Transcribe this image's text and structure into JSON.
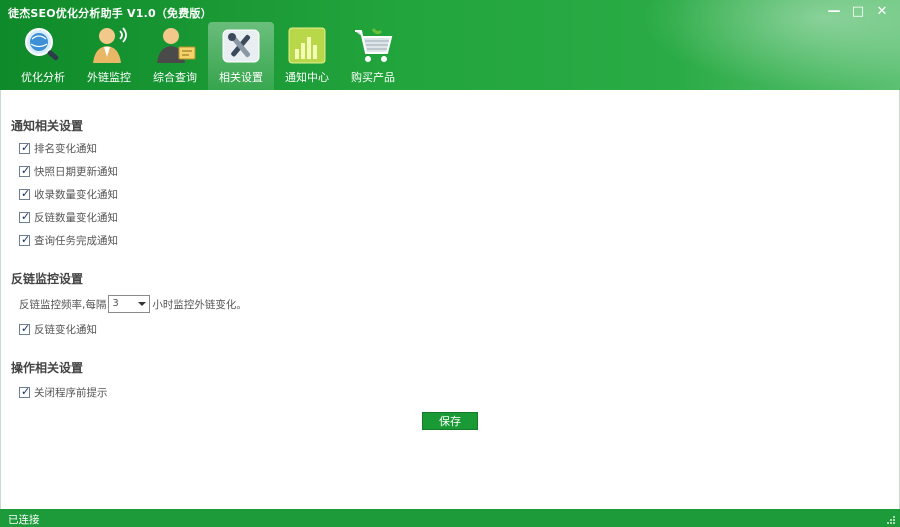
{
  "app": {
    "title": "徒杰SEO优化分析助手 V1.0（免费版）"
  },
  "window_controls": {
    "minimize": "—",
    "maximize": "□",
    "close": "✕"
  },
  "nav": {
    "items": [
      {
        "label": "优化分析",
        "icon": "magnifier-globe-icon"
      },
      {
        "label": "外链监控",
        "icon": "person-monitor-icon"
      },
      {
        "label": "综合查询",
        "icon": "person-card-icon"
      },
      {
        "label": "相关设置",
        "icon": "tools-settings-icon",
        "active": true
      },
      {
        "label": "通知中心",
        "icon": "bar-chart-icon"
      },
      {
        "label": "购买产品",
        "icon": "shopping-cart-icon"
      }
    ]
  },
  "notify": {
    "title": "通知相关设置",
    "options": [
      {
        "label": "排名变化通知",
        "checked": true
      },
      {
        "label": "快照日期更新通知",
        "checked": true
      },
      {
        "label": "收录数量变化通知",
        "checked": true
      },
      {
        "label": "反链数量变化通知",
        "checked": true
      },
      {
        "label": "查询任务完成通知",
        "checked": true
      }
    ]
  },
  "backlink": {
    "title": "反链监控设置",
    "freq_prefix": "反链监控频率,每隔",
    "freq_value": "3",
    "freq_suffix": "小时监控外链变化。",
    "option": {
      "label": "反链变化通知",
      "checked": true
    }
  },
  "operation": {
    "title": "操作相关设置",
    "option": {
      "label": "关闭程序前提示",
      "checked": true
    }
  },
  "save_label": "保存",
  "status": {
    "text": "已连接"
  },
  "colors": {
    "brand_green": "#1d9a3a",
    "header_dark": "#0f8a2a",
    "header_light": "#5cc172"
  }
}
